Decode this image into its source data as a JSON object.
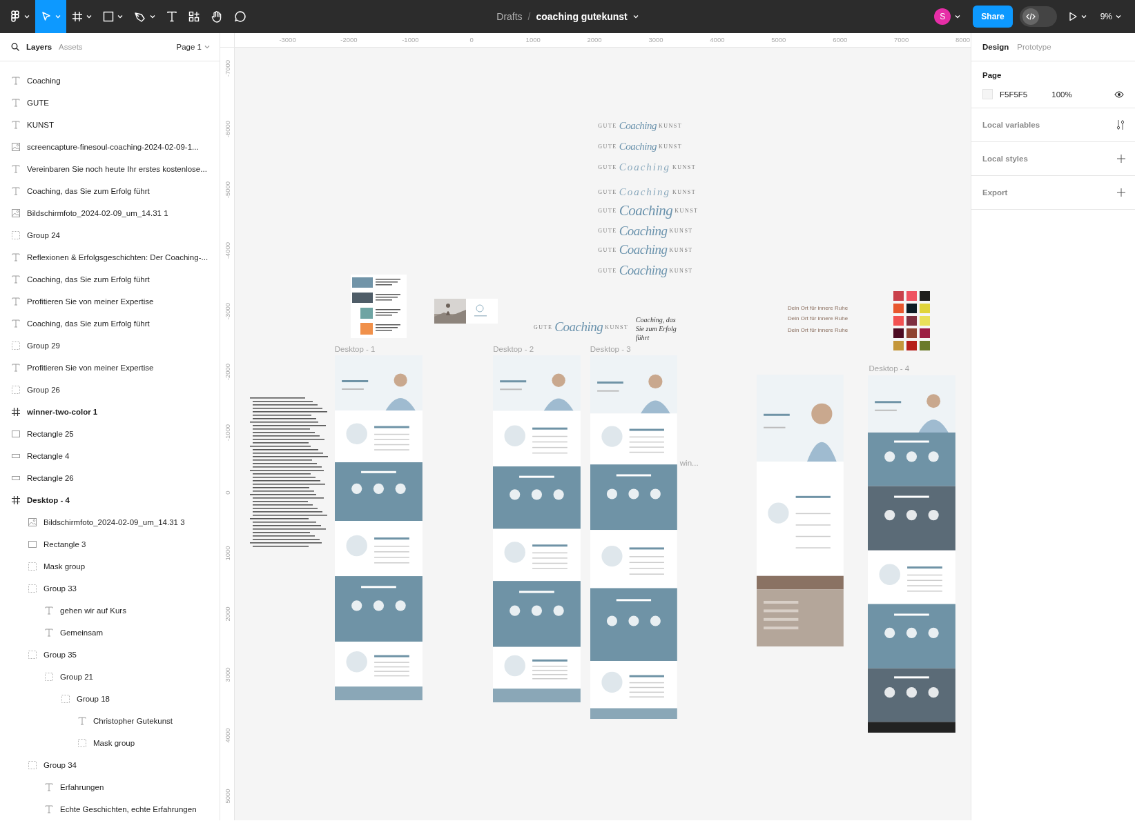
{
  "toolbar": {
    "tools": [
      {
        "kind": "main-menu",
        "selected": false,
        "menu": true
      },
      {
        "kind": "move",
        "selected": true,
        "menu": true
      },
      {
        "kind": "frame",
        "selected": false,
        "menu": true
      },
      {
        "kind": "shape",
        "selected": false,
        "menu": true
      },
      {
        "kind": "pen",
        "selected": false,
        "menu": true
      },
      {
        "kind": "text",
        "selected": false,
        "menu": false
      },
      {
        "kind": "resources",
        "selected": false,
        "menu": false
      },
      {
        "kind": "hand",
        "selected": false,
        "menu": false
      },
      {
        "kind": "comment",
        "selected": false,
        "menu": false
      }
    ],
    "breadcrumb": "Drafts",
    "separator": "/",
    "file_name": "coaching gutekunst",
    "avatar": "S",
    "share": "Share",
    "dev_mode": false,
    "zoom": "9%"
  },
  "layers_panel": {
    "tabs": [
      {
        "label": "Layers",
        "selected": true
      },
      {
        "label": "Assets",
        "selected": false
      }
    ],
    "page": "Page 1",
    "layers": [
      {
        "name": "Coaching",
        "kind": "text"
      },
      {
        "name": "GUTE",
        "kind": "text"
      },
      {
        "name": "KUNST",
        "kind": "text"
      },
      {
        "name": "screencapture-finesoul-coaching-2024-02-09-1...",
        "kind": "image"
      },
      {
        "name": "Vereinbaren Sie noch heute Ihr erstes kostenlose...",
        "kind": "text"
      },
      {
        "name": "Coaching, das Sie zum Erfolg führt",
        "kind": "text"
      },
      {
        "name": "Bildschirmfoto_2024-02-09_um_14.31 1",
        "kind": "image"
      },
      {
        "name": "Group 24",
        "kind": "group"
      },
      {
        "name": "Reflexionen & Erfolgsgeschichten: Der Coaching-...",
        "kind": "text"
      },
      {
        "name": "Coaching, das Sie zum Erfolg führt",
        "kind": "text"
      },
      {
        "name": "Profitieren Sie von meiner Expertise",
        "kind": "text"
      },
      {
        "name": "Coaching, das Sie zum Erfolg führt",
        "kind": "text"
      },
      {
        "name": "Group 29",
        "kind": "group"
      },
      {
        "name": "Profitieren Sie von meiner Expertise",
        "kind": "text"
      },
      {
        "name": "Group 26",
        "kind": "group"
      },
      {
        "name": "winner-two-color 1",
        "kind": "frame"
      },
      {
        "name": "Rectangle 25",
        "kind": "rectangle"
      },
      {
        "name": "Rectangle 4",
        "kind": "line-rectangle"
      },
      {
        "name": "Rectangle 26",
        "kind": "line-rectangle"
      },
      {
        "name": "Desktop - 4",
        "kind": "frame",
        "children": [
          {
            "name": "Bildschirmfoto_2024-02-09_um_14.31 3",
            "kind": "image"
          },
          {
            "name": "Rectangle 3",
            "kind": "rectangle"
          },
          {
            "name": "Mask group",
            "kind": "group"
          },
          {
            "name": "Group 33",
            "kind": "group",
            "children": [
              {
                "name": "gehen wir auf Kurs",
                "kind": "text"
              },
              {
                "name": "Gemeinsam",
                "kind": "text"
              }
            ]
          },
          {
            "name": "Group 35",
            "kind": "group",
            "children": [
              {
                "name": "Group 21",
                "kind": "group",
                "children": [
                  {
                    "name": "Group 18",
                    "kind": "group",
                    "children": [
                      {
                        "name": "Christopher Gutekunst",
                        "kind": "text"
                      },
                      {
                        "name": "Mask group",
                        "kind": "group"
                      }
                    ]
                  }
                ]
              }
            ]
          },
          {
            "name": "Group 34",
            "kind": "group",
            "children": [
              {
                "name": "Erfahrungen",
                "kind": "text"
              },
              {
                "name": "Echte Geschichten, echte Erfahrungen",
                "kind": "text"
              }
            ]
          }
        ]
      }
    ]
  },
  "rulers": {
    "horizontal": [
      "-3000",
      "-2000",
      "-1000",
      "0",
      "1000",
      "2000",
      "3000",
      "4000",
      "5000",
      "6000",
      "7000",
      "8000"
    ],
    "vertical": [
      "-7000",
      "-6000",
      "-5000",
      "-4000",
      "-3000",
      "-2000",
      "-1000",
      "0",
      "1000",
      "2000",
      "3000",
      "4000",
      "5000"
    ]
  },
  "canvas": {
    "logos": [
      {
        "left": "GUTE",
        "script": "Coaching",
        "right": "KUNST"
      },
      {
        "left": "GUTE",
        "script": "Coaching",
        "right": "KUNST"
      },
      {
        "left": "GUTE",
        "script": "Coaching",
        "right": "KUNST"
      },
      {
        "left": "GUTE",
        "script": "Coaching",
        "right": "KUNST"
      },
      {
        "left": "GUTE",
        "script": "Coaching",
        "right": "KUNST"
      },
      {
        "left": "GUTE",
        "script": "Coaching",
        "right": "KUNST"
      },
      {
        "left": "GUTE",
        "script": "Coaching",
        "right": "KUNST"
      },
      {
        "left": "GUTE",
        "script": "Coaching",
        "right": "KUNST"
      },
      {
        "left": "GUTE",
        "script": "Coaching",
        "right": "KUNST"
      }
    ],
    "handwriting": "Coaching, das Sie zum Erfolg führt",
    "taglines": [
      "Dein Ort für innere Ruhe",
      "Dein Ort für innere Ruhe",
      "Dein Ort für innere Ruhe"
    ],
    "frames": [
      {
        "label": "Desktop - 1"
      },
      {
        "label": "Desktop - 2"
      },
      {
        "label": "Desktop - 3"
      },
      {
        "label": "Desktop - 4"
      },
      {
        "label": "win..."
      }
    ],
    "swatches": [
      {
        "color": "#c9404a"
      },
      {
        "color": "#ef5361"
      },
      {
        "color": "#1e1e1c"
      },
      {
        "color": "#e8572e"
      },
      {
        "color": "#0c1b24"
      },
      {
        "color": "#e0d43a"
      },
      {
        "color": "#f25252"
      },
      {
        "color": "#7e3040"
      },
      {
        "color": "#e9e05a"
      },
      {
        "color": "#4d0b22"
      },
      {
        "color": "#8f4431"
      },
      {
        "color": "#9c1d42"
      },
      {
        "color": "#c4963a"
      },
      {
        "color": "#b61e1a"
      },
      {
        "color": "#6b7a2a"
      }
    ]
  },
  "design_panel": {
    "tabs": [
      {
        "label": "Design",
        "selected": true
      },
      {
        "label": "Prototype",
        "selected": false
      }
    ],
    "page_section": {
      "title": "Page",
      "color": "F5F5F5",
      "opacity": "100%",
      "visible": true
    },
    "sections": [
      {
        "label": "Local variables",
        "kind": "variables"
      },
      {
        "label": "Local styles",
        "kind": "add"
      },
      {
        "label": "Export",
        "kind": "add"
      }
    ]
  }
}
